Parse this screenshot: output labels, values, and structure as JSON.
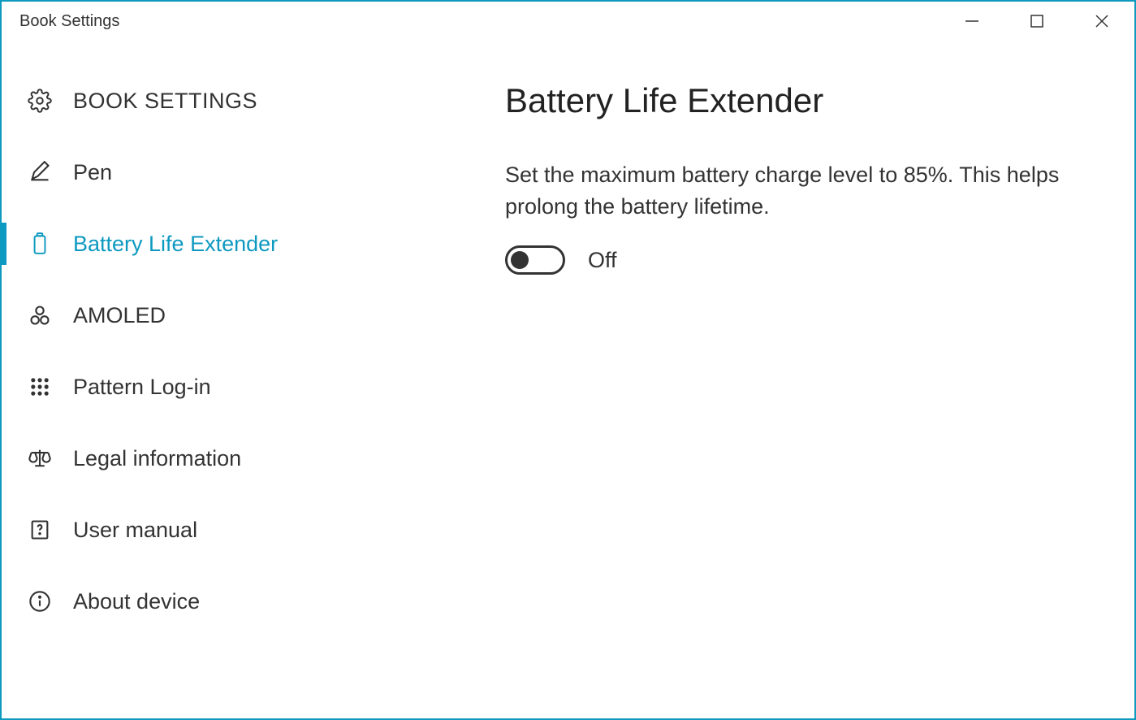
{
  "window": {
    "title": "Book Settings"
  },
  "sidebar": {
    "heading": "BOOK SETTINGS",
    "items": [
      {
        "label": "Pen"
      },
      {
        "label": "Battery Life Extender"
      },
      {
        "label": "AMOLED"
      },
      {
        "label": "Pattern Log-in"
      },
      {
        "label": "Legal information"
      },
      {
        "label": "User manual"
      },
      {
        "label": "About device"
      }
    ]
  },
  "main": {
    "title": "Battery Life Extender",
    "description": "Set the maximum battery charge level to 85%. This helps prolong the battery lifetime.",
    "toggle_label": "Off"
  }
}
